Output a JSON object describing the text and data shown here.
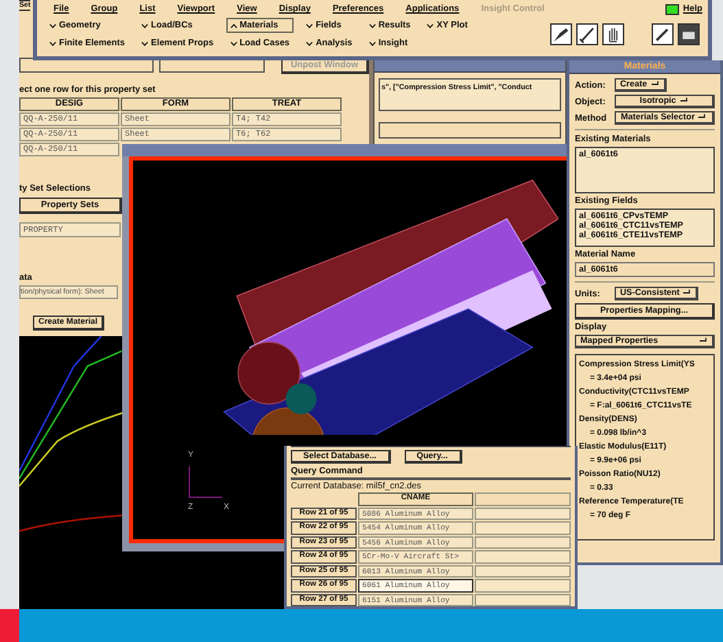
{
  "menu_bar": {
    "items": [
      {
        "label": "File",
        "disabled": false
      },
      {
        "label": "Group",
        "disabled": false
      },
      {
        "label": "List",
        "disabled": false
      },
      {
        "label": "Viewport",
        "disabled": false
      },
      {
        "label": "View",
        "disabled": false
      },
      {
        "label": "Display",
        "disabled": false
      },
      {
        "label": "Preferences",
        "disabled": false
      },
      {
        "label": "Applications",
        "disabled": false
      },
      {
        "label": "Insight Control",
        "disabled": true
      }
    ],
    "help": "Help"
  },
  "app_tabs": [
    {
      "label": "Geometry",
      "selected": false
    },
    {
      "label": "Load/BCs",
      "selected": false
    },
    {
      "label": "Materials",
      "selected": true
    },
    {
      "label": "Fields",
      "selected": false
    },
    {
      "label": "Results",
      "selected": false
    },
    {
      "label": "XY Plot",
      "selected": false
    },
    {
      "label": "Finite Elements",
      "selected": false
    },
    {
      "label": "Element Props",
      "selected": false
    },
    {
      "label": "Load Cases",
      "selected": false
    },
    {
      "label": "Analysis",
      "selected": false
    },
    {
      "label": "Insight",
      "selected": false
    }
  ],
  "property_window": {
    "set_label": "Set",
    "unpost_button": "Unpost Window",
    "instruction": "ect one row for this property set",
    "columns": [
      "DESIG",
      "FORM",
      "TREAT"
    ],
    "rows": [
      [
        "QQ-A-250/11",
        "Sheet",
        "T4; T42"
      ],
      [
        "QQ-A-250/11",
        "Sheet",
        "T6; T62"
      ],
      [
        "QQ-A-250/11"
      ]
    ],
    "selections_heading": "ty Set Selections",
    "property_sets_button": "Property Sets",
    "property_item": "PROPERTY",
    "data_heading": "ata",
    "form_text": "tion/physical form): Sheet",
    "create_button": "Create Material"
  },
  "command_window": {
    "text": "s\", [\"Compression Stress Limit\", \"Conduct"
  },
  "viewport": {
    "axis_labels": [
      "Y",
      "Z",
      "X"
    ]
  },
  "materials_panel": {
    "title": "Materials",
    "action_label": "Action:",
    "action": "Create",
    "object_label": "Object:",
    "object": "Isotropic",
    "method_label": "Method",
    "method": "Materials Selector",
    "existing_materials_label": "Existing Materials",
    "existing_materials": [
      "al_6061t6"
    ],
    "existing_fields_label": "Existing Fields",
    "existing_fields": [
      "al_6061t6_CPvsTEMP",
      "al_6061t6_CTC11vsTEMP",
      "al_6061t6_CTE11vsTEMP"
    ],
    "material_name_label": "Material Name",
    "material_name": "al_6061t6",
    "units_label": "Units:",
    "units": "US-Consistent",
    "mapping_button": "Properties Mapping...",
    "display_label": "Display",
    "display": "Mapped Properties",
    "properties": [
      {
        "name": "Compression Stress Limit(YS",
        "value": "= 3.4e+04  psi"
      },
      {
        "name": "Conductivity(CTC11vsTEMP",
        "value": "= F:al_6061t6_CTC11vsTE"
      },
      {
        "name": "Density(DENS)",
        "value": "= 0.098  lb/in^3"
      },
      {
        "name": "Elastic Modulus(E11T)",
        "value": "= 9.9e+06  psi"
      },
      {
        "name": "Poisson Ratio(NU12)",
        "value": "= 0.33"
      },
      {
        "name": "Reference Temperature(TE",
        "value": "= 70  deg F"
      }
    ]
  },
  "query_window": {
    "select_button": "Select Database...",
    "query_button": "Query...",
    "command_label": "Query Command",
    "database_text": "Current Database: mil5f_cn2.des",
    "column": "CNAME",
    "rows": [
      {
        "label": "Row 21 of 95",
        "value": "5086 Aluminum Alloy",
        "selected": false
      },
      {
        "label": "Row 22 of 95",
        "value": "5454 Aluminum Alloy",
        "selected": false
      },
      {
        "label": "Row 23 of 95",
        "value": "5456 Aluminum Alloy",
        "selected": false
      },
      {
        "label": "Row 24 of 95",
        "value": "5Cr-Mo-V Aircraft St>",
        "selected": false
      },
      {
        "label": "Row 25 of 95",
        "value": "6013 Aluminum Alloy",
        "selected": false
      },
      {
        "label": "Row 26 of 95",
        "value": "6061 Aluminum Alloy",
        "selected": true
      },
      {
        "label": "Row 27 of 95",
        "value": "6151 Aluminum Alloy",
        "selected": false
      }
    ]
  }
}
